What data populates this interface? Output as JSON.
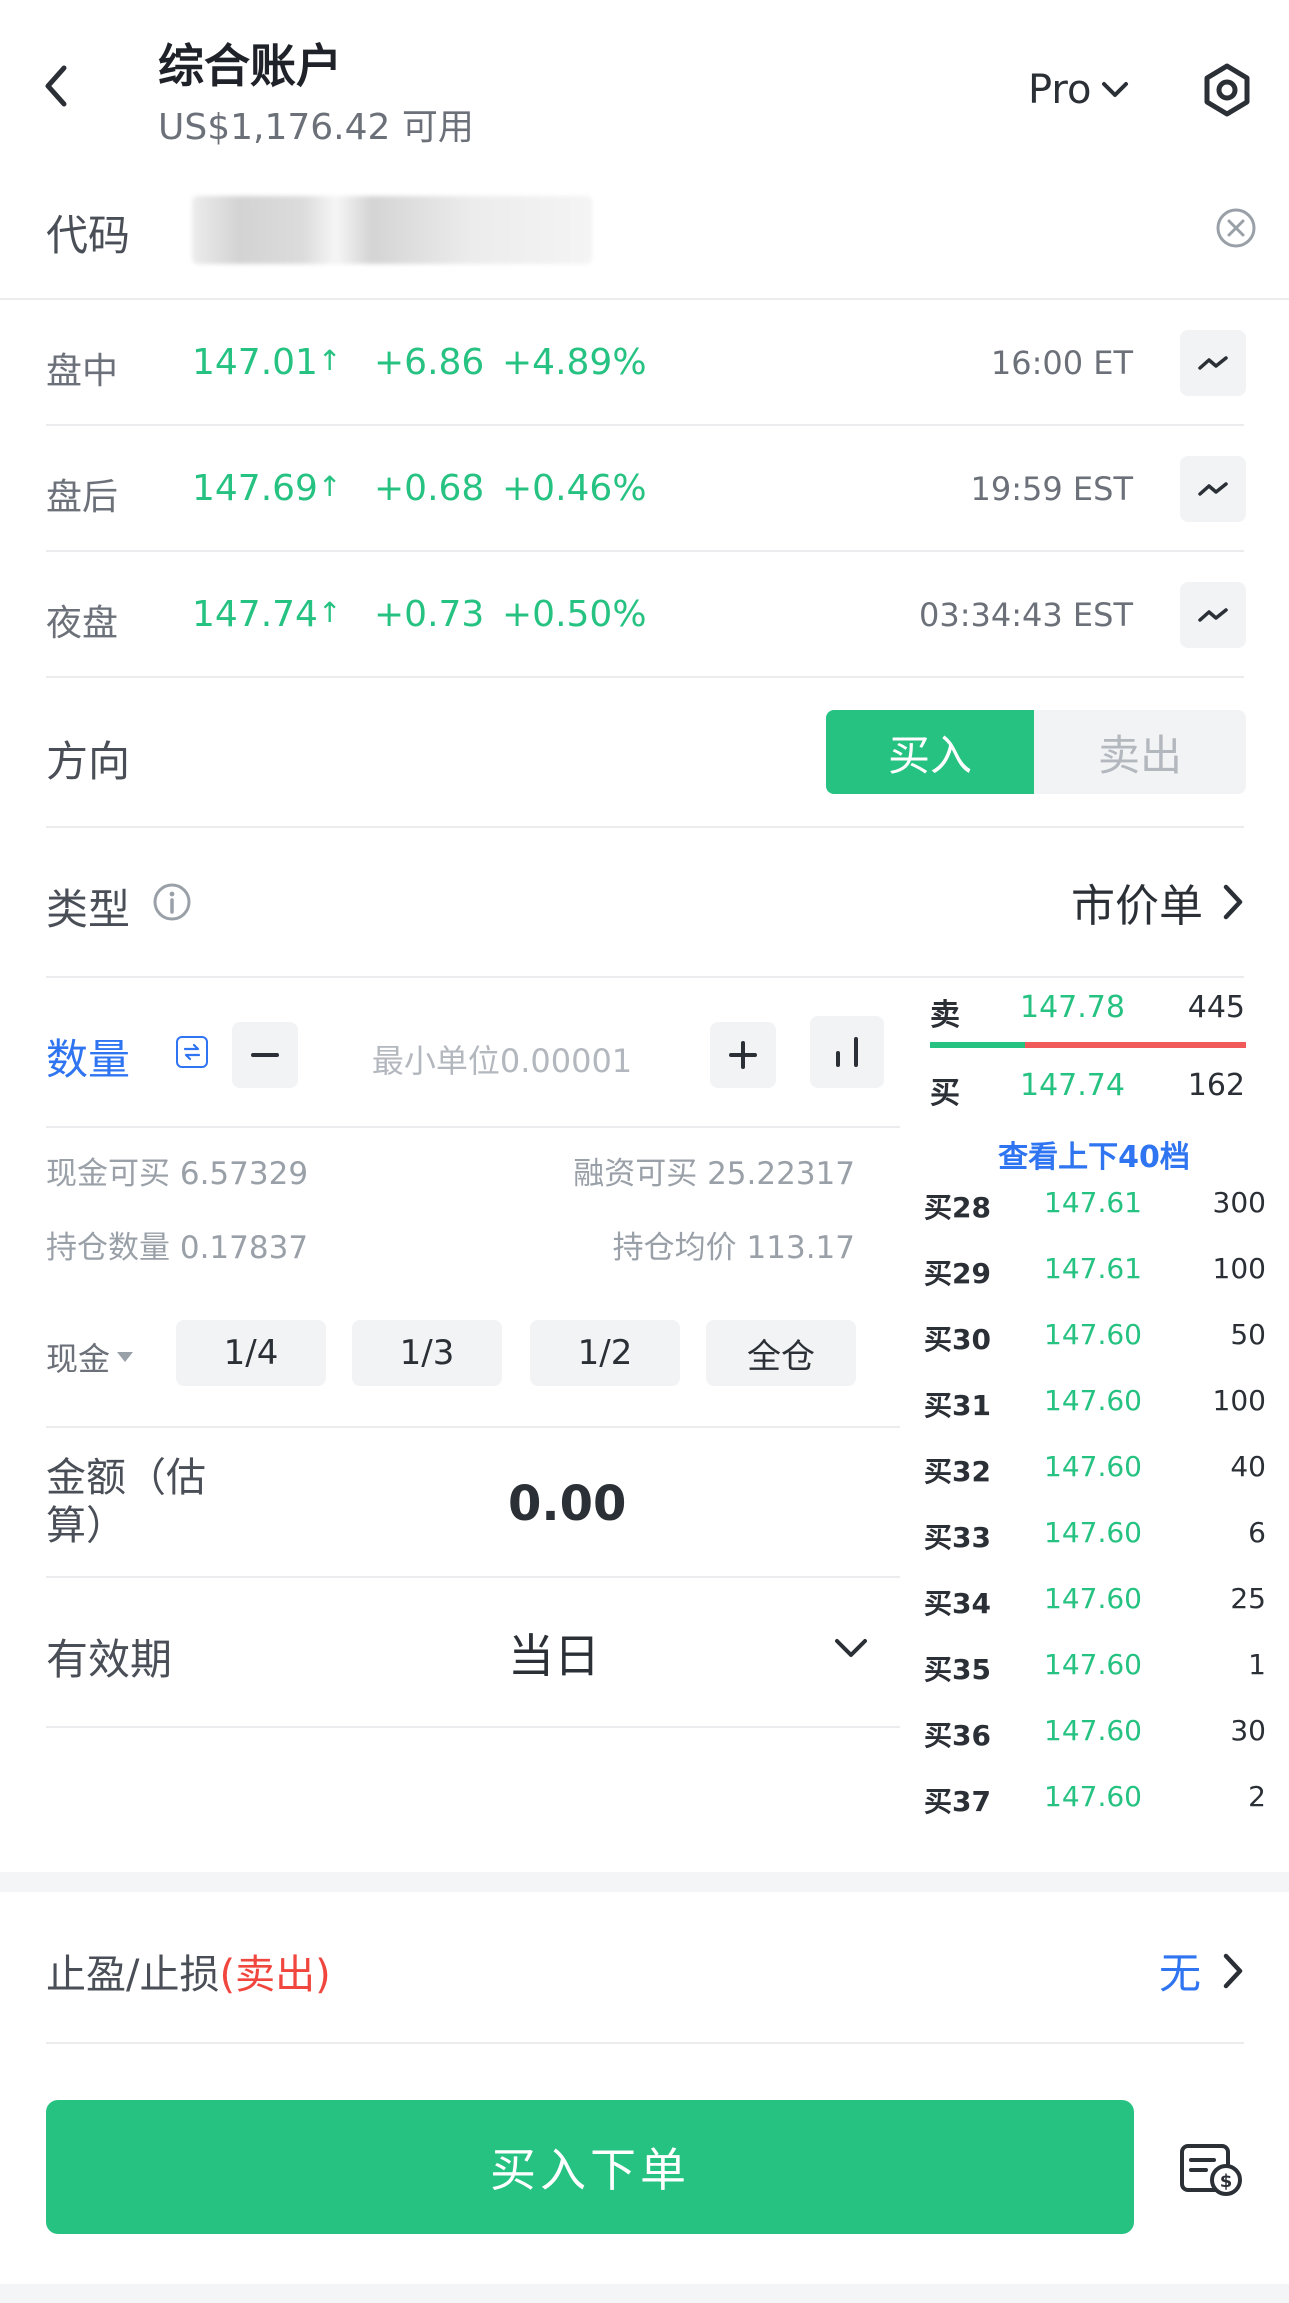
{
  "header": {
    "title": "综合账户",
    "subtitle": "US$1,176.42 可用",
    "mode_label": "Pro"
  },
  "code": {
    "label": "代码"
  },
  "quotes": [
    {
      "session": "盘中",
      "price": "147.01",
      "change": "+6.86",
      "pct": "+4.89%",
      "time": "16:00 ET"
    },
    {
      "session": "盘后",
      "price": "147.69",
      "change": "+0.68",
      "pct": "+0.46%",
      "time": "19:59 EST"
    },
    {
      "session": "夜盘",
      "price": "147.74",
      "change": "+0.73",
      "pct": "+0.50%",
      "time": "03:34:43 EST"
    }
  ],
  "direction": {
    "label": "方向",
    "buy": "买入",
    "sell": "卖出"
  },
  "order_type": {
    "label": "类型",
    "value": "市价单"
  },
  "quantity": {
    "label": "数量",
    "placeholder": "最小单位0.00001",
    "cash_buyable": "现金可买 6.57329",
    "margin_buyable": "融资可买 25.22317",
    "position_qty": "持仓数量 0.17837",
    "avg_price": "持仓均价 113.17"
  },
  "fraction": {
    "account": "现金",
    "options": [
      "1/4",
      "1/3",
      "1/2",
      "全仓"
    ]
  },
  "amount": {
    "label_line1": "金额（估",
    "label_line2": "算）",
    "value": "0.00"
  },
  "validity": {
    "label": "有效期",
    "value": "当日"
  },
  "orderbook": {
    "ask": {
      "label": "卖",
      "price": "147.78",
      "qty": "445"
    },
    "bid": {
      "label": "买",
      "price": "147.74",
      "qty": "162"
    },
    "ask_ratio": 0.3,
    "view_more": "查看上下40档",
    "levels": [
      {
        "level": "买28",
        "price": "147.61",
        "qty": "300"
      },
      {
        "level": "买29",
        "price": "147.61",
        "qty": "100"
      },
      {
        "level": "买30",
        "price": "147.60",
        "qty": "50"
      },
      {
        "level": "买31",
        "price": "147.60",
        "qty": "100"
      },
      {
        "level": "买32",
        "price": "147.60",
        "qty": "40"
      },
      {
        "level": "买33",
        "price": "147.60",
        "qty": "6"
      },
      {
        "level": "买34",
        "price": "147.60",
        "qty": "25"
      },
      {
        "level": "买35",
        "price": "147.60",
        "qty": "1"
      },
      {
        "level": "买36",
        "price": "147.60",
        "qty": "30"
      },
      {
        "level": "买37",
        "price": "147.60",
        "qty": "2"
      }
    ]
  },
  "tp_sl": {
    "label": "止盈/止损",
    "side": "(卖出)",
    "value": "无"
  },
  "submit": {
    "label": "买入下单"
  },
  "colors": {
    "green": "#26c281",
    "red": "#f0463e",
    "blue": "#2f74f0"
  }
}
